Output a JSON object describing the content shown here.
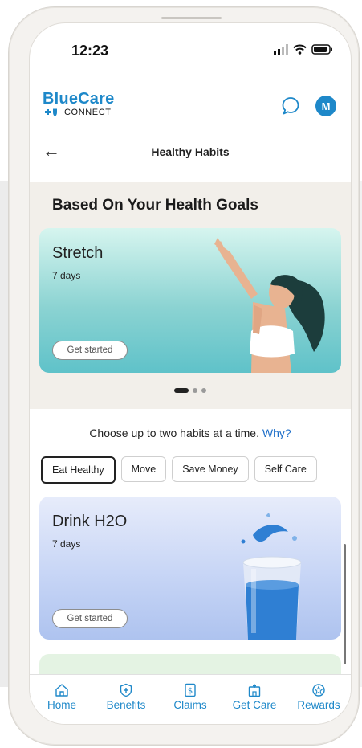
{
  "status_bar": {
    "time": "12:23"
  },
  "header": {
    "brand_name": "BlueCare",
    "brand_sub": "CONNECT",
    "avatar_initial": "M"
  },
  "nav": {
    "title": "Healthy Habits"
  },
  "goals": {
    "title": "Based On Your Health Goals",
    "card": {
      "title": "Stretch",
      "duration": "7 days",
      "button": "Get started"
    },
    "carousel": {
      "current": 1,
      "total": 3
    }
  },
  "habits": {
    "prompt": "Choose up to two habits at a time.",
    "why_link": "Why?",
    "chips": [
      {
        "label": "Eat Healthy",
        "selected": true
      },
      {
        "label": "Move",
        "selected": false
      },
      {
        "label": "Save Money",
        "selected": false
      },
      {
        "label": "Self Care",
        "selected": false
      }
    ],
    "card": {
      "title": "Drink H2O",
      "duration": "7 days",
      "button": "Get started"
    }
  },
  "tabbar": {
    "items": [
      {
        "label": "Home",
        "icon": "home-icon"
      },
      {
        "label": "Benefits",
        "icon": "shield-plus-icon"
      },
      {
        "label": "Claims",
        "icon": "dollar-document-icon"
      },
      {
        "label": "Get Care",
        "icon": "hospital-icon"
      },
      {
        "label": "Rewards",
        "icon": "badge-icon"
      }
    ]
  },
  "colors": {
    "brand": "#1e88c9",
    "link": "#1e6fc9",
    "goals_bg": "#f2efea"
  }
}
